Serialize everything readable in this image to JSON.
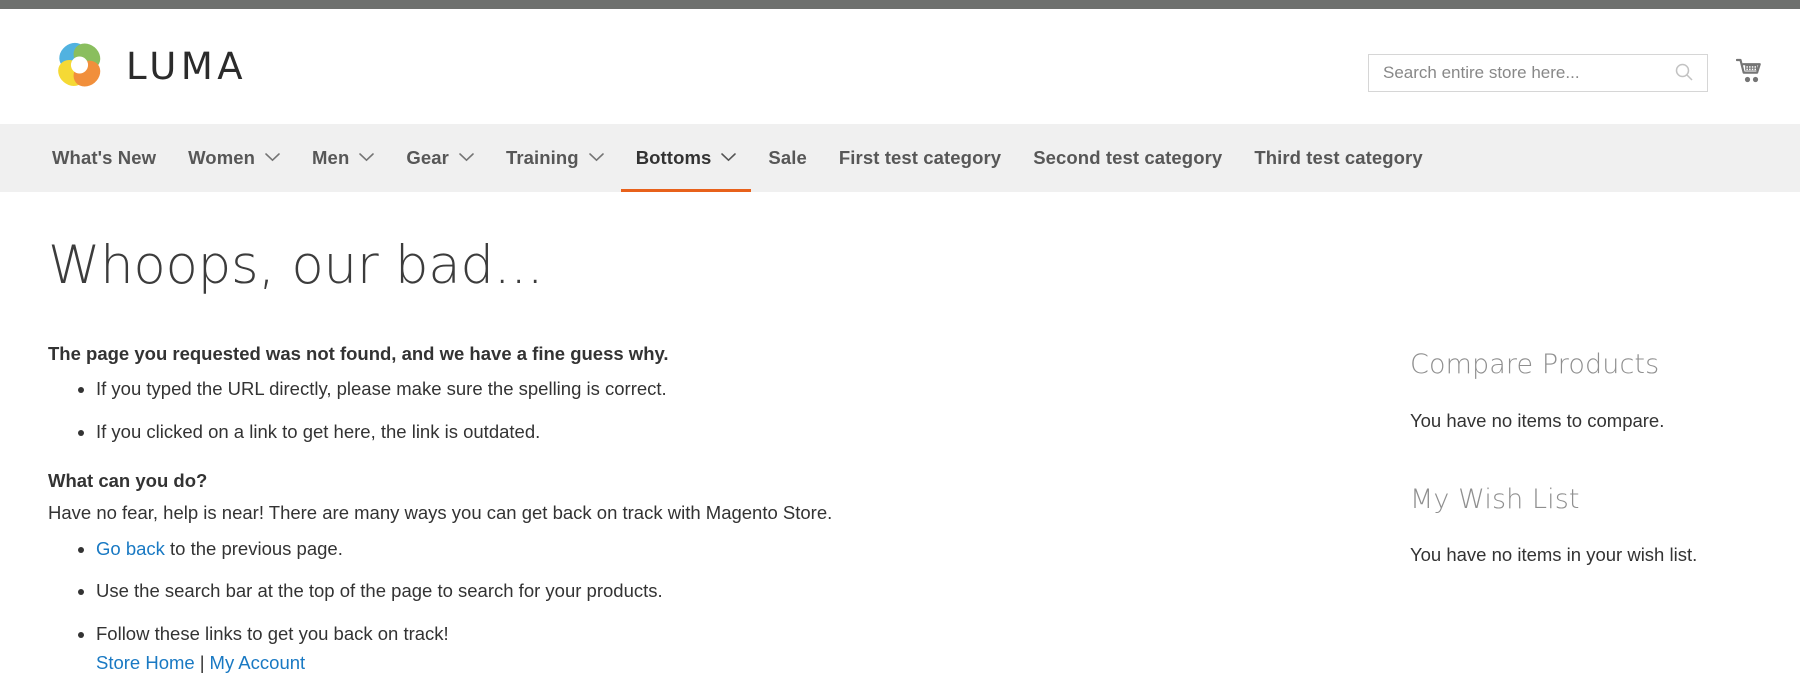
{
  "brand": {
    "name": "LUMA",
    "logo_icon": "luma-flower-logo",
    "logo_colors": [
      "#3aa8dc",
      "#7ab648",
      "#f4d41a",
      "#f08020"
    ]
  },
  "topbar": {
    "color": "#6e706e"
  },
  "header": {
    "search": {
      "placeholder": "Search entire store here...",
      "value": "",
      "icon": "search-icon"
    },
    "cart": {
      "icon": "shopping-cart-icon",
      "count": ""
    }
  },
  "nav": {
    "active_color": "#e8611b",
    "items": [
      {
        "label": "What's New",
        "has_submenu": false,
        "active": false
      },
      {
        "label": "Women",
        "has_submenu": true,
        "active": false
      },
      {
        "label": "Men",
        "has_submenu": true,
        "active": false
      },
      {
        "label": "Gear",
        "has_submenu": true,
        "active": false
      },
      {
        "label": "Training",
        "has_submenu": true,
        "active": false
      },
      {
        "label": "Bottoms",
        "has_submenu": true,
        "active": true
      },
      {
        "label": "Sale",
        "has_submenu": false,
        "active": false
      },
      {
        "label": "First test category",
        "has_submenu": false,
        "active": false
      },
      {
        "label": "Second test category",
        "has_submenu": false,
        "active": false
      },
      {
        "label": "Third test category",
        "has_submenu": false,
        "active": false
      }
    ]
  },
  "main": {
    "title": "Whoops, our bad...",
    "lead": "The page you requested was not found, and we have a fine guess why.",
    "reasons": [
      "If you typed the URL directly, please make sure the spelling is correct.",
      "If you clicked on a link to get here, the link is outdated."
    ],
    "subhead": "What can you do?",
    "paragraph": "Have no fear, help is near! There are many ways you can get back on track with Magento Store.",
    "action_go_back_link": "Go back",
    "action_go_back_rest": " to the previous page.",
    "action_search": "Use the search bar at the top of the page to search for your products.",
    "action_follow": "Follow these links to get you back on track!",
    "link_store_home": "Store Home",
    "link_separator": "|",
    "link_my_account": "My Account",
    "link_color": "#1979c3"
  },
  "sidebar": {
    "compare": {
      "title": "Compare Products",
      "empty_text": "You have no items to compare."
    },
    "wishlist": {
      "title": "My Wish List",
      "empty_text": "You have no items in your wish list."
    }
  }
}
